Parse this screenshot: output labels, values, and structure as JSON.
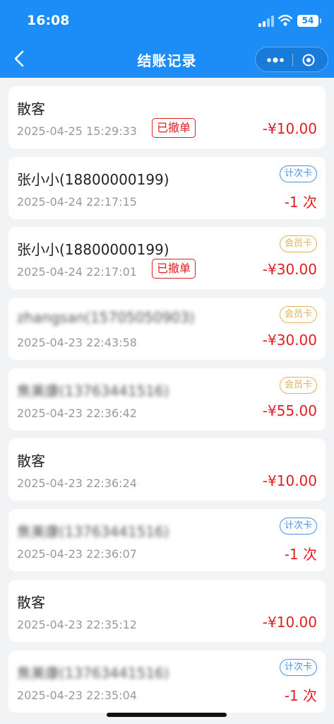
{
  "status": {
    "time": "16:08",
    "battery": "54"
  },
  "nav": {
    "title": "结账记录"
  },
  "records": [
    {
      "name": "散客",
      "blurred": false,
      "date": "2025-04-25 15:29:33",
      "amount": "-¥10.00",
      "revoked": "已撤单",
      "tag": ""
    },
    {
      "name": "张小小(18800000199)",
      "blurred": false,
      "date": "2025-04-24 22:17:15",
      "amount": "-1 次",
      "revoked": "",
      "tag": "计次卡",
      "tag_type": "count"
    },
    {
      "name": "张小小(18800000199)",
      "blurred": false,
      "date": "2025-04-24 22:17:01",
      "amount": "-¥30.00",
      "revoked": "已撤单",
      "tag": "会员卡",
      "tag_type": "member"
    },
    {
      "name": "zhangsan(15705050903)",
      "blurred": true,
      "date": "2025-04-23 22:43:58",
      "amount": "-¥30.00",
      "revoked": "",
      "tag": "会员卡",
      "tag_type": "member"
    },
    {
      "name": "焦美康(13763441516)",
      "blurred": true,
      "date": "2025-04-23 22:36:42",
      "amount": "-¥55.00",
      "revoked": "",
      "tag": "会员卡",
      "tag_type": "member"
    },
    {
      "name": "散客",
      "blurred": false,
      "date": "2025-04-23 22:36:24",
      "amount": "-¥10.00",
      "revoked": "",
      "tag": ""
    },
    {
      "name": "焦美康(13763441516)",
      "blurred": true,
      "date": "2025-04-23 22:36:07",
      "amount": "-1 次",
      "revoked": "",
      "tag": "计次卡",
      "tag_type": "count"
    },
    {
      "name": "散客",
      "blurred": false,
      "date": "2025-04-23 22:35:12",
      "amount": "-¥10.00",
      "revoked": "",
      "tag": ""
    },
    {
      "name": "焦美康(13763441516)",
      "blurred": true,
      "date": "2025-04-23 22:35:04",
      "amount": "-1 次",
      "revoked": "",
      "tag": "计次卡",
      "tag_type": "count"
    }
  ]
}
